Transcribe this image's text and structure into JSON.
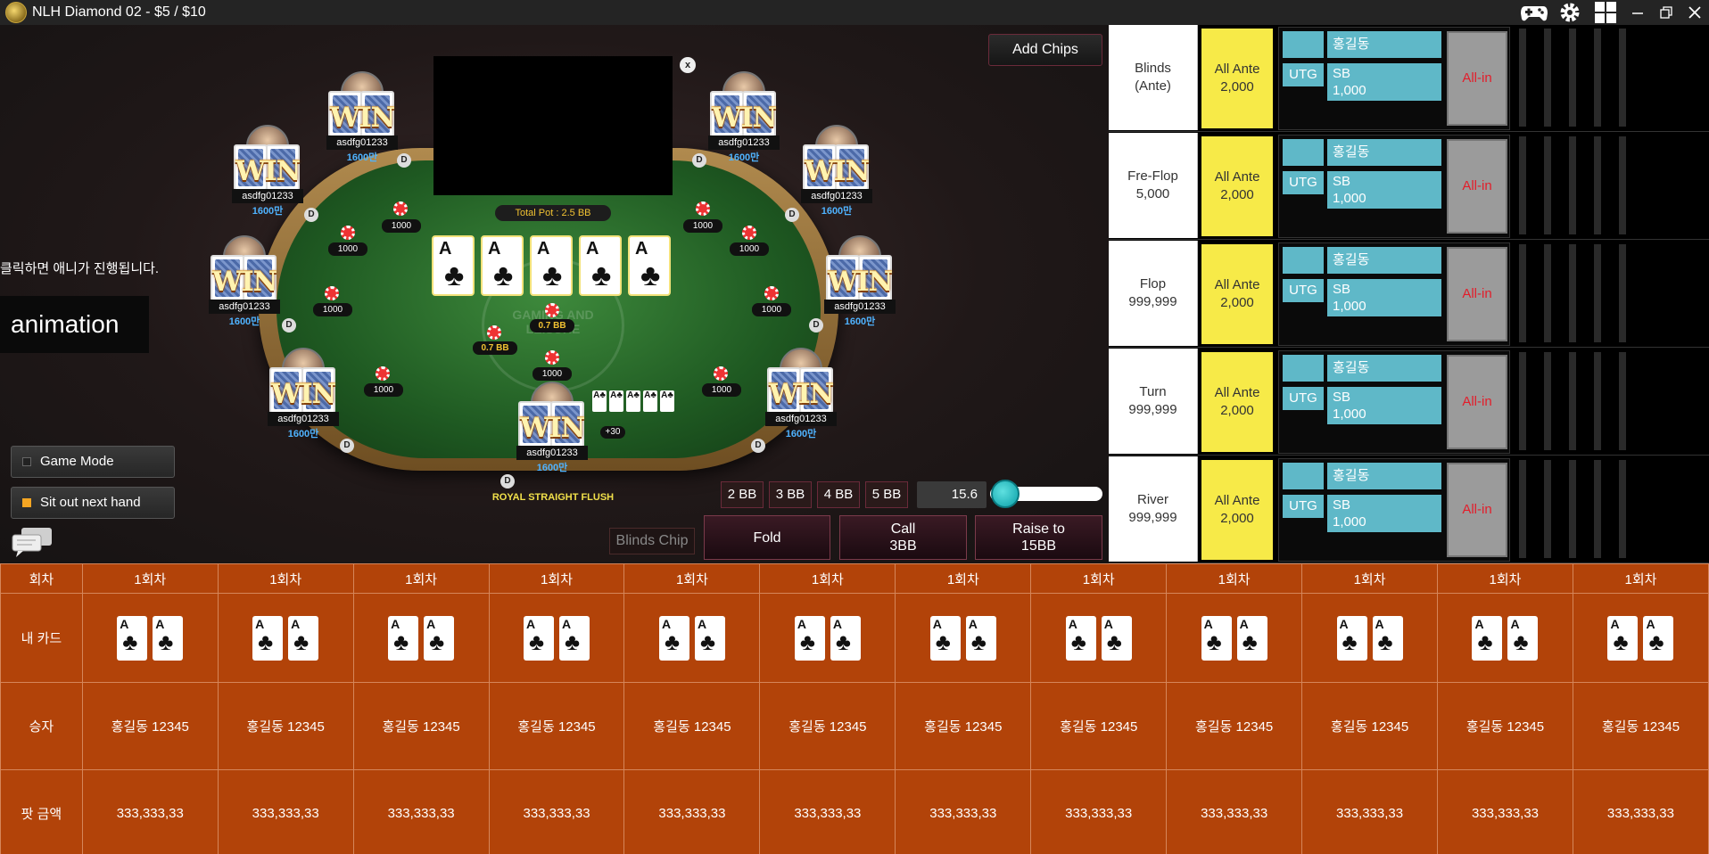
{
  "window": {
    "title": "NLH Diamond 02 - $5 / $10"
  },
  "icons": {
    "gamepad": "gamepad-icon",
    "settings": "gear-icon",
    "layout": "grid-icon",
    "minimize": "minimize-icon",
    "restore": "restore-icon",
    "close": "close-icon"
  },
  "table": {
    "total_pot": "Total Pot : 2.5 BB",
    "watermark": "GAMING AND LEISURE",
    "video_close": "x",
    "board": [
      {
        "rank": "A",
        "suit": "♣"
      },
      {
        "rank": "A",
        "suit": "♣"
      },
      {
        "rank": "A",
        "suit": "♣"
      },
      {
        "rank": "A",
        "suit": "♣"
      },
      {
        "rank": "A",
        "suit": "♣"
      }
    ],
    "bets": [
      "1000",
      "1000",
      "1000",
      "1000",
      "1000",
      "1000",
      "1000",
      "1000",
      "1000",
      "1000"
    ],
    "bb_bets": [
      "0.7 BB",
      "0.7 BB"
    ],
    "win_text": "WIN",
    "dealer": "D",
    "seats": [
      {
        "name": "asdfg01233",
        "stack": "1600만"
      },
      {
        "name": "asdfg01233",
        "stack": "1600만"
      },
      {
        "name": "asdfg01233",
        "stack": "1600만"
      },
      {
        "name": "asdfg01233",
        "stack": "1600만"
      },
      {
        "name": "asdfg01233",
        "stack": "1600만"
      },
      {
        "name": "asdfg01233",
        "stack": "1600만"
      },
      {
        "name": "asdfg01233",
        "stack": "1600만"
      },
      {
        "name": "asdfg01233",
        "stack": "1600만"
      },
      {
        "name": "asdfg01233",
        "stack": "1600만"
      }
    ],
    "hero": {
      "name": "asdfg01233",
      "stack": "1600만",
      "hand_strength": "ROYAL STRAIGHT FLUSH",
      "plus": "+30",
      "mini_cards": [
        "A♣",
        "A♣",
        "A♣",
        "A♣",
        "A♣"
      ]
    }
  },
  "left_panel": {
    "click_message": "클릭하면 애니가 진행됩니다.",
    "animation_label": "animation",
    "game_mode": "Game Mode",
    "sit_out": "Sit out next hand",
    "game_mode_checked": false,
    "sit_out_checked": true
  },
  "controls": {
    "add_chips": "Add Chips",
    "bb_buttons": [
      "2 BB",
      "3 BB",
      "4 BB",
      "5 BB"
    ],
    "slider_value": "15.6",
    "slider_fraction": 0.05,
    "blinds_chip": "Blinds Chip",
    "fold": "Fold",
    "call_line1": "Call",
    "call_line2": "3BB",
    "raise_line1": "Raise to",
    "raise_line2": "15BB"
  },
  "right_panel": {
    "rows": [
      {
        "street1": "Blinds",
        "street2": "(Ante)",
        "ante1": "All Ante",
        "ante2": "2,000",
        "name": "홍길동",
        "utg": "UTG",
        "sb1": "SB",
        "sb2": "1,000",
        "allin": "All-in"
      },
      {
        "street1": "Fre-Flop",
        "street2": "5,000",
        "ante1": "All Ante",
        "ante2": "2,000",
        "name": "홍길동",
        "utg": "UTG",
        "sb1": "SB",
        "sb2": "1,000",
        "allin": "All-in"
      },
      {
        "street1": "Flop",
        "street2": "999,999",
        "ante1": "All Ante",
        "ante2": "2,000",
        "name": "홍길동",
        "utg": "UTG",
        "sb1": "SB",
        "sb2": "1,000",
        "allin": "All-in"
      },
      {
        "street1": "Turn",
        "street2": "999,999",
        "ante1": "All Ante",
        "ante2": "2,000",
        "name": "홍길동",
        "utg": "UTG",
        "sb1": "SB",
        "sb2": "1,000",
        "allin": "All-in"
      },
      {
        "street1": "River",
        "street2": "999,999",
        "ante1": "All Ante",
        "ante2": "2,000",
        "name": "홍길동",
        "utg": "UTG",
        "sb1": "SB",
        "sb2": "1,000",
        "allin": "All-in"
      }
    ]
  },
  "history": {
    "row_labels": {
      "round": "회차",
      "my_cards": "내 카드",
      "winner": "승자",
      "pot": "팟 금액"
    },
    "columns": [
      {
        "round": "1회차",
        "cards": [
          "A",
          "A"
        ],
        "suit": "♣",
        "winner": "홍길동 12345",
        "pot": "333,333,33"
      },
      {
        "round": "1회차",
        "cards": [
          "A",
          "A"
        ],
        "suit": "♣",
        "winner": "홍길동 12345",
        "pot": "333,333,33"
      },
      {
        "round": "1회차",
        "cards": [
          "A",
          "A"
        ],
        "suit": "♣",
        "winner": "홍길동 12345",
        "pot": "333,333,33"
      },
      {
        "round": "1회차",
        "cards": [
          "A",
          "A"
        ],
        "suit": "♣",
        "winner": "홍길동 12345",
        "pot": "333,333,33"
      },
      {
        "round": "1회차",
        "cards": [
          "A",
          "A"
        ],
        "suit": "♣",
        "winner": "홍길동 12345",
        "pot": "333,333,33"
      },
      {
        "round": "1회차",
        "cards": [
          "A",
          "A"
        ],
        "suit": "♣",
        "winner": "홍길동 12345",
        "pot": "333,333,33"
      },
      {
        "round": "1회차",
        "cards": [
          "A",
          "A"
        ],
        "suit": "♣",
        "winner": "홍길동 12345",
        "pot": "333,333,33"
      },
      {
        "round": "1회차",
        "cards": [
          "A",
          "A"
        ],
        "suit": "♣",
        "winner": "홍길동 12345",
        "pot": "333,333,33"
      },
      {
        "round": "1회차",
        "cards": [
          "A",
          "A"
        ],
        "suit": "♣",
        "winner": "홍길동 12345",
        "pot": "333,333,33"
      },
      {
        "round": "1회차",
        "cards": [
          "A",
          "A"
        ],
        "suit": "♣",
        "winner": "홍길동 12345",
        "pot": "333,333,33"
      },
      {
        "round": "1회차",
        "cards": [
          "A",
          "A"
        ],
        "suit": "♣",
        "winner": "홍길동 12345",
        "pot": "333,333,33"
      },
      {
        "round": "1회차",
        "cards": [
          "A",
          "A"
        ],
        "suit": "♣",
        "winner": "홍길동 12345",
        "pot": "333,333,33"
      }
    ]
  }
}
